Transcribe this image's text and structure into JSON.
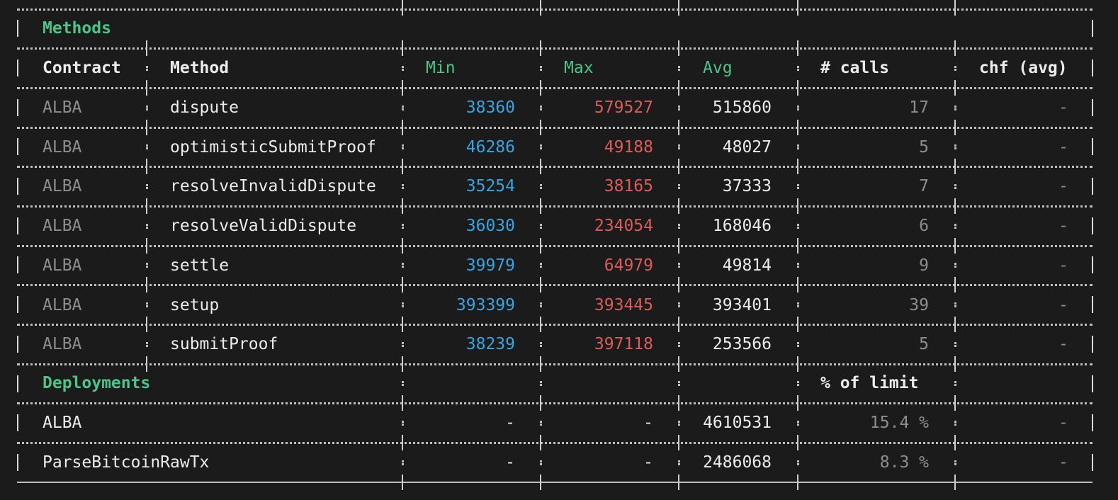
{
  "table": {
    "methods_section_title": "Methods",
    "deployments_section_title": "Deployments",
    "headers": {
      "contract": "Contract",
      "method": "Method",
      "min": "Min",
      "max": "Max",
      "avg": "Avg",
      "calls": "# calls",
      "chf": "chf (avg)",
      "percent_of_limit": "% of limit"
    },
    "methods": [
      {
        "contract": "ALBA",
        "method": "dispute",
        "min": "38360",
        "max": "579527",
        "avg": "515860",
        "calls": "17",
        "chf": "-"
      },
      {
        "contract": "ALBA",
        "method": "optimisticSubmitProof",
        "min": "46286",
        "max": "49188",
        "avg": "48027",
        "calls": "5",
        "chf": "-"
      },
      {
        "contract": "ALBA",
        "method": "resolveInvalidDispute",
        "min": "35254",
        "max": "38165",
        "avg": "37333",
        "calls": "7",
        "chf": "-"
      },
      {
        "contract": "ALBA",
        "method": "resolveValidDispute",
        "min": "36030",
        "max": "234054",
        "avg": "168046",
        "calls": "6",
        "chf": "-"
      },
      {
        "contract": "ALBA",
        "method": "settle",
        "min": "39979",
        "max": "64979",
        "avg": "49814",
        "calls": "9",
        "chf": "-"
      },
      {
        "contract": "ALBA",
        "method": "setup",
        "min": "393399",
        "max": "393445",
        "avg": "393401",
        "calls": "39",
        "chf": "-"
      },
      {
        "contract": "ALBA",
        "method": "submitProof",
        "min": "38239",
        "max": "397118",
        "avg": "253566",
        "calls": "5",
        "chf": "-"
      }
    ],
    "deployments": [
      {
        "name": "ALBA",
        "min": "-",
        "max": "-",
        "avg": "4610531",
        "percent": "15.4 %",
        "chf": "-"
      },
      {
        "name": "ParseBitcoinRawTx",
        "min": "-",
        "max": "-",
        "avg": "2486068",
        "percent": "8.3 %",
        "chf": "-"
      }
    ],
    "colors": {
      "background": "#1b1b1b",
      "header_green": "#4ec48a",
      "min_blue": "#3aa3e0",
      "max_red": "#e05a5a",
      "muted_grey": "#8d8d8d"
    }
  }
}
